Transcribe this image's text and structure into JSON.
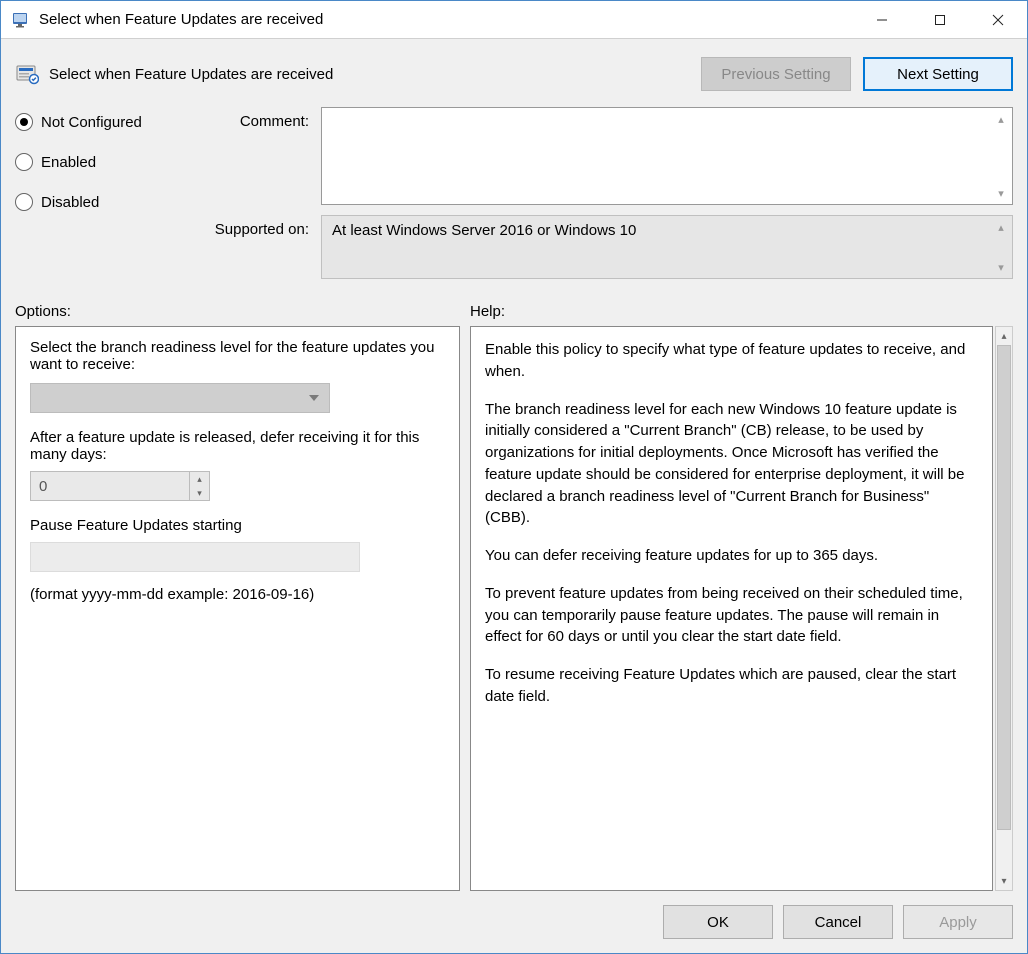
{
  "window": {
    "title": "Select when Feature Updates are received"
  },
  "header": {
    "title": "Select when Feature Updates are received",
    "prev_label": "Previous Setting",
    "next_label": "Next Setting"
  },
  "state": {
    "radios": {
      "not_configured": "Not Configured",
      "enabled": "Enabled",
      "disabled": "Disabled",
      "selected": "not_configured"
    },
    "comment_label": "Comment:",
    "supported_label": "Supported on:",
    "supported_value": "At least Windows Server 2016 or Windows 10"
  },
  "sections": {
    "options_label": "Options:",
    "help_label": "Help:"
  },
  "options": {
    "branch_text": "Select the branch readiness level for the feature updates you want to receive:",
    "defer_text": "After a feature update is released, defer receiving it for this many days:",
    "defer_value": "0",
    "pause_text": "Pause Feature Updates starting",
    "format_hint": "(format yyyy-mm-dd example: 2016-09-16)"
  },
  "help": {
    "p1": "Enable this policy to specify what type of feature updates to receive, and when.",
    "p2": "The branch readiness level for each new Windows 10 feature update is initially considered a \"Current Branch\" (CB) release, to be used by organizations for initial deployments. Once Microsoft has verified the feature update should be considered for enterprise deployment, it will be declared a branch readiness level of \"Current Branch for Business\" (CBB).",
    "p3": "You can defer receiving feature updates for up to 365 days.",
    "p4": "To prevent feature updates from being received on their scheduled time, you can temporarily pause feature updates. The pause will remain in effect for 60 days or until you clear the start date field.",
    "p5": "To resume receiving Feature Updates which are paused, clear the start date field."
  },
  "footer": {
    "ok": "OK",
    "cancel": "Cancel",
    "apply": "Apply"
  }
}
